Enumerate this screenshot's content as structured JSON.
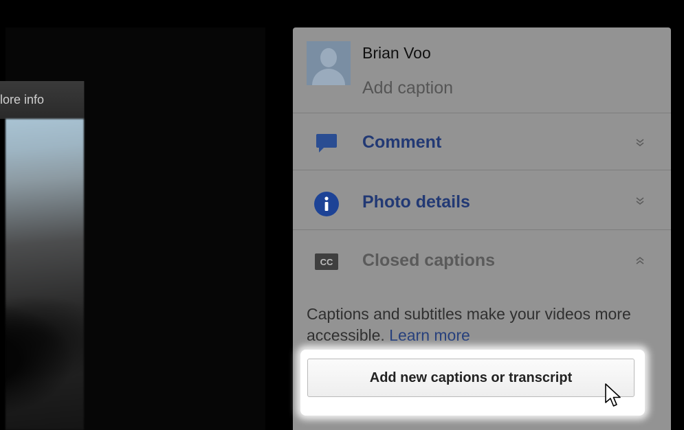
{
  "viewer": {
    "more_info_label": "More info",
    "more_info_visible": "lore info"
  },
  "user": {
    "name": "Brian Voo",
    "caption_placeholder": "Add caption"
  },
  "sections": {
    "comment": {
      "label": "Comment",
      "icon": "speech-bubble-icon",
      "state": "collapsed"
    },
    "photo_details": {
      "label": "Photo details",
      "icon": "info-icon",
      "state": "collapsed"
    },
    "closed_captions": {
      "label": "Closed captions",
      "icon": "cc-icon",
      "icon_text": "CC",
      "state": "expanded"
    }
  },
  "captions": {
    "description": "Captions and subtitles make your videos more accessible.",
    "learn_more": "Learn more",
    "add_button": "Add new captions or transcript"
  },
  "colors": {
    "panel_bg": "#939393",
    "link_blue": "#223974",
    "info_icon_blue": "#1d4396"
  }
}
